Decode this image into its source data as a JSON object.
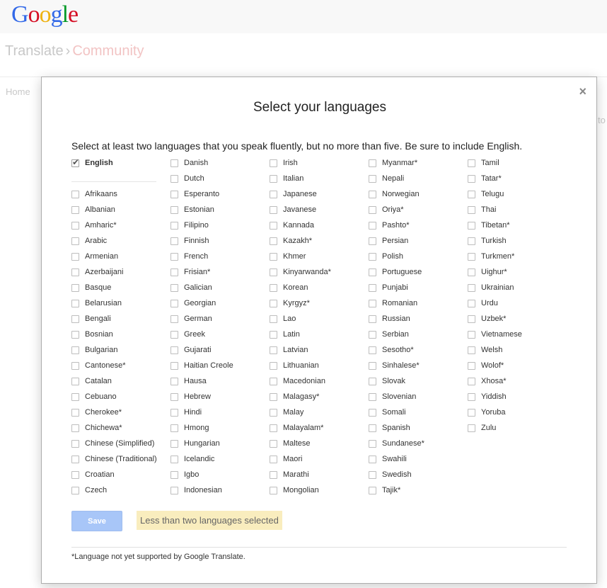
{
  "header": {
    "logo_letters": [
      {
        "ch": "G",
        "color": "#3369e8"
      },
      {
        "ch": "o",
        "color": "#d50f25"
      },
      {
        "ch": "o",
        "color": "#eeb211"
      },
      {
        "ch": "g",
        "color": "#3369e8"
      },
      {
        "ch": "l",
        "color": "#009925"
      },
      {
        "ch": "e",
        "color": "#d50f25"
      }
    ],
    "breadcrumb_translate": "Translate",
    "breadcrumb_sep": "›",
    "breadcrumb_community": "Community",
    "home_tab": "Home",
    "bg_text_fragment": "to"
  },
  "dialog": {
    "close_glyph": "×",
    "title": "Select your languages",
    "instructions": "Select at least two languages that you speak fluently, but no more than five. Be sure to include English.",
    "save_label": "Save",
    "warning": "Less than two languages selected",
    "footnote": "*Language not yet supported by Google Translate.",
    "english": {
      "label": "English",
      "checked": true
    },
    "columns": [
      [
        "Afrikaans",
        "Albanian",
        "Amharic*",
        "Arabic",
        "Armenian",
        "Azerbaijani",
        "Basque",
        "Belarusian",
        "Bengali",
        "Bosnian",
        "Bulgarian",
        "Cantonese*",
        "Catalan",
        "Cebuano",
        "Cherokee*",
        "Chichewa*",
        "Chinese (Simplified)",
        "Chinese (Traditional)",
        "Croatian",
        "Czech"
      ],
      [
        "Danish",
        "Dutch",
        "Esperanto",
        "Estonian",
        "Filipino",
        "Finnish",
        "French",
        "Frisian*",
        "Galician",
        "Georgian",
        "German",
        "Greek",
        "Gujarati",
        "Haitian Creole",
        "Hausa",
        "Hebrew",
        "Hindi",
        "Hmong",
        "Hungarian",
        "Icelandic",
        "Igbo",
        "Indonesian"
      ],
      [
        "Irish",
        "Italian",
        "Japanese",
        "Javanese",
        "Kannada",
        "Kazakh*",
        "Khmer",
        "Kinyarwanda*",
        "Korean",
        "Kyrgyz*",
        "Lao",
        "Latin",
        "Latvian",
        "Lithuanian",
        "Macedonian",
        "Malagasy*",
        "Malay",
        "Malayalam*",
        "Maltese",
        "Maori",
        "Marathi",
        "Mongolian"
      ],
      [
        "Myanmar*",
        "Nepali",
        "Norwegian",
        "Oriya*",
        "Pashto*",
        "Persian",
        "Polish",
        "Portuguese",
        "Punjabi",
        "Romanian",
        "Russian",
        "Serbian",
        "Sesotho*",
        "Sinhalese*",
        "Slovak",
        "Slovenian",
        "Somali",
        "Spanish",
        "Sundanese*",
        "Swahili",
        "Swedish",
        "Tajik*"
      ],
      [
        "Tamil",
        "Tatar*",
        "Telugu",
        "Thai",
        "Tibetan*",
        "Turkish",
        "Turkmen*",
        "Uighur*",
        "Ukrainian",
        "Urdu",
        "Uzbek*",
        "Vietnamese",
        "Welsh",
        "Wolof*",
        "Xhosa*",
        "Yiddish",
        "Yoruba",
        "Zulu"
      ]
    ]
  }
}
